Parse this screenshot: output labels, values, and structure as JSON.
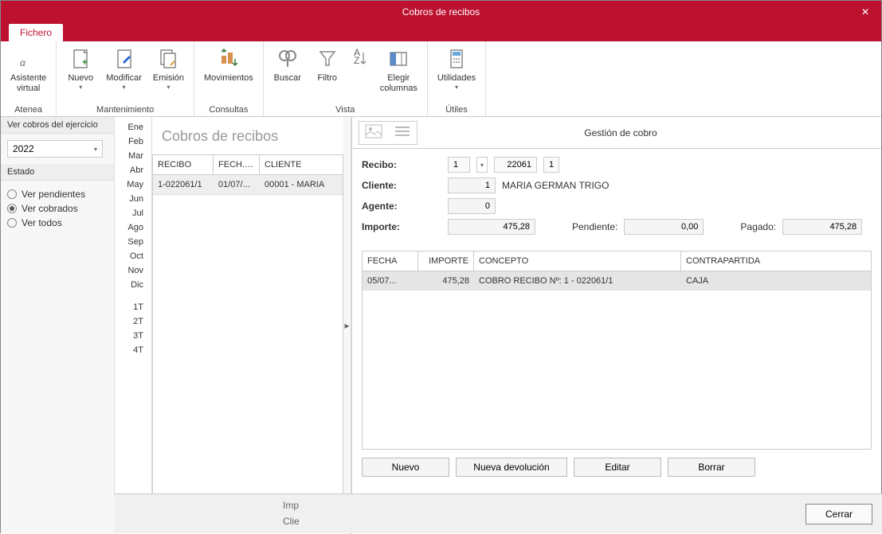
{
  "window": {
    "title": "Cobros de recibos"
  },
  "tabs": {
    "fichero": "Fichero"
  },
  "ribbon": {
    "groups": [
      {
        "label": "Atenea",
        "items": [
          {
            "label": "Asistente\nvirtual"
          }
        ]
      },
      {
        "label": "Mantenimiento",
        "items": [
          {
            "label": "Nuevo"
          },
          {
            "label": "Modificar"
          },
          {
            "label": "Emisión"
          }
        ]
      },
      {
        "label": "Consultas",
        "items": [
          {
            "label": "Movimientos"
          }
        ]
      },
      {
        "label": "Vista",
        "items": [
          {
            "label": "Buscar"
          },
          {
            "label": "Filtro"
          },
          {
            "label": ""
          },
          {
            "label": "Elegir\ncolumnas"
          }
        ]
      },
      {
        "label": "Útiles",
        "items": [
          {
            "label": "Utilidades"
          }
        ]
      }
    ]
  },
  "leftPanel": {
    "section1": "Ver cobros del ejercicio",
    "year": "2022",
    "section2": "Estado",
    "radios": [
      {
        "label": "Ver pendientes",
        "checked": false
      },
      {
        "label": "Ver cobrados",
        "checked": true
      },
      {
        "label": "Ver todos",
        "checked": false
      }
    ]
  },
  "months": [
    "Ene",
    "Feb",
    "Mar",
    "Abr",
    "May",
    "Jun",
    "Jul",
    "Ago",
    "Sep",
    "Oct",
    "Nov",
    "Dic",
    "",
    "1T",
    "2T",
    "3T",
    "4T"
  ],
  "centerGrid": {
    "title": "Cobros de recibos",
    "headers": [
      "RECIBO",
      "FECH. ...",
      "CLIENTE"
    ],
    "row": [
      "1-022061/1",
      "01/07/...",
      "00001 - MARIA"
    ]
  },
  "detail": {
    "title": "Gestión de cobro",
    "labels": {
      "recibo": "Recibo:",
      "cliente": "Cliente:",
      "agente": "Agente:",
      "importe": "Importe:",
      "pendiente": "Pendiente:",
      "pagado": "Pagado:"
    },
    "recibo": {
      "serie": "1",
      "num": "22061",
      "suffix": "1"
    },
    "cliente": {
      "num": "1",
      "nombre": "MARIA GERMAN TRIGO"
    },
    "agente": "0",
    "importe": "475,28",
    "pendiente": "0,00",
    "pagado": "475,28",
    "gridHeaders": [
      "FECHA",
      "IMPORTE",
      "CONCEPTO",
      "CONTRAPARTIDA"
    ],
    "gridRow": [
      "05/07...",
      "475,28",
      "COBRO RECIBO Nº: 1 - 022061/1",
      "CAJA"
    ],
    "buttons": {
      "nuevo": "Nuevo",
      "devolucion": "Nueva devolución",
      "editar": "Editar",
      "borrar": "Borrar"
    }
  },
  "footer": {
    "line1": "Imp",
    "line2": "Clie",
    "cerrar": "Cerrar"
  }
}
